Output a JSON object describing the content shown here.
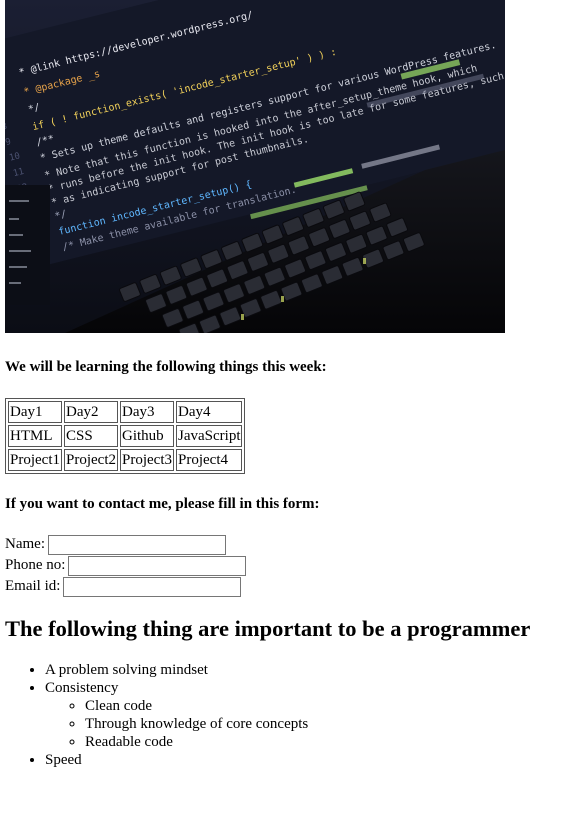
{
  "hero": {
    "code_lines": [
      "* @link https://developer.wordpress.org/",
      "* @package _s",
      "*/",
      "if ( ! function_exists( 'incode_starter_setup' ) ) :",
      "/**",
      " * Sets up theme defaults and registers support for various WordPress features.",
      " * Note that this function is hooked into the after_setup_theme hook, which",
      " * runs before the init hook. The init hook is too late for some features, such",
      " * as indicating support for post thumbnails.",
      " */",
      "function incode_starter_setup() {",
      "  /* Make theme available for translation."
    ]
  },
  "schedule": {
    "heading": "We will be learning the following things this week:",
    "rows": [
      [
        "Day1",
        "Day2",
        "Day3",
        "Day4"
      ],
      [
        "HTML",
        "CSS",
        "Github",
        "JavaScript"
      ],
      [
        "Project1",
        "Project2",
        "Project3",
        "Project4"
      ]
    ]
  },
  "contact": {
    "heading": "If you want to contact me, please fill in this form:",
    "name_label": "Name:",
    "name_value": "",
    "phone_label": "Phone no:",
    "phone_value": "",
    "email_label": "Email id:",
    "email_value": ""
  },
  "programmer": {
    "title": "The following thing are important to be a programmer",
    "items": {
      "item0": "A problem solving mindset",
      "item1": "Consistency",
      "sub": [
        "Clean code",
        "Through knowledge of core concepts",
        "Readable code"
      ],
      "item2": "Speed"
    }
  }
}
